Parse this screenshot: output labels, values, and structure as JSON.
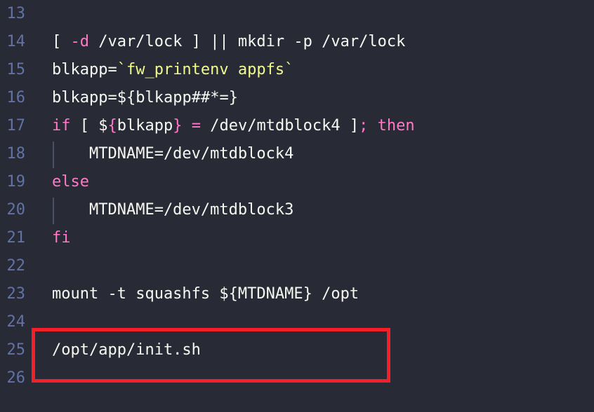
{
  "editor": {
    "background_color": "#282a36",
    "gutter_color": "#6272a4",
    "default_text_color": "#f8f8f2",
    "font_size_px": 22,
    "line_height_px": 40,
    "first_line_number": 13,
    "last_line_number": 26
  },
  "palette": {
    "keyword": "#ff79c6",
    "string": "#f1fa8c",
    "variable": "#bd93f9",
    "operator": "#ff79c6",
    "plain": "#f8f8f2",
    "comment": "#6272a4",
    "annotation_red": "#f42029",
    "indent_guide": "#4b5066"
  },
  "lines": [
    {
      "number": "13",
      "indent_guide": false,
      "tokens": []
    },
    {
      "number": "14",
      "indent_guide": false,
      "tokens": [
        {
          "t": "[ ",
          "c": "plain"
        },
        {
          "t": "-d",
          "c": "keyword"
        },
        {
          "t": " /var/lock ] ",
          "c": "plain"
        },
        {
          "t": "||",
          "c": "operator"
        },
        {
          "t": " mkdir -p /var/lock",
          "c": "plain"
        }
      ]
    },
    {
      "number": "15",
      "indent_guide": false,
      "tokens": [
        {
          "t": "blkapp=",
          "c": "plain"
        },
        {
          "t": "`fw_printenv appfs`",
          "c": "string"
        }
      ]
    },
    {
      "number": "16",
      "indent_guide": false,
      "tokens": [
        {
          "t": "blkapp=",
          "c": "plain"
        },
        {
          "t": "$",
          "c": "variable"
        },
        {
          "t": "{",
          "c": "plain"
        },
        {
          "t": "blkapp",
          "c": "variable"
        },
        {
          "t": "##*=",
          "c": "operator"
        },
        {
          "t": "}",
          "c": "plain"
        }
      ]
    },
    {
      "number": "17",
      "indent_guide": false,
      "tokens": [
        {
          "t": "if",
          "c": "keyword"
        },
        {
          "t": " [ ",
          "c": "plain"
        },
        {
          "t": "$",
          "c": "variable"
        },
        {
          "t": "{",
          "c": "keyword"
        },
        {
          "t": "blkapp",
          "c": "variable"
        },
        {
          "t": "}",
          "c": "keyword"
        },
        {
          "t": " ",
          "c": "plain"
        },
        {
          "t": "=",
          "c": "keyword"
        },
        {
          "t": " /dev/mtdblock4 ]",
          "c": "plain"
        },
        {
          "t": ";",
          "c": "keyword"
        },
        {
          "t": " ",
          "c": "plain"
        },
        {
          "t": "then",
          "c": "keyword"
        }
      ]
    },
    {
      "number": "18",
      "indent_guide": true,
      "tokens": [
        {
          "t": "    MTDNAME=/dev/mtdblock4",
          "c": "plain"
        }
      ]
    },
    {
      "number": "19",
      "indent_guide": false,
      "tokens": [
        {
          "t": "else",
          "c": "keyword"
        }
      ]
    },
    {
      "number": "20",
      "indent_guide": true,
      "tokens": [
        {
          "t": "    MTDNAME=/dev/mtdblock3",
          "c": "plain"
        }
      ]
    },
    {
      "number": "21",
      "indent_guide": false,
      "tokens": [
        {
          "t": "fi",
          "c": "keyword"
        }
      ]
    },
    {
      "number": "22",
      "indent_guide": false,
      "tokens": []
    },
    {
      "number": "23",
      "indent_guide": false,
      "tokens": [
        {
          "t": "mount -t squashfs ",
          "c": "plain"
        },
        {
          "t": "$",
          "c": "variable"
        },
        {
          "t": "{",
          "c": "plain"
        },
        {
          "t": "MTDNAME",
          "c": "variable"
        },
        {
          "t": "}",
          "c": "plain"
        },
        {
          "t": " /opt",
          "c": "plain"
        }
      ]
    },
    {
      "number": "24",
      "indent_guide": false,
      "tokens": []
    },
    {
      "number": "25",
      "indent_guide": false,
      "tokens": [
        {
          "t": "/opt/app/init.sh",
          "c": "plain"
        }
      ]
    },
    {
      "number": "26",
      "indent_guide": false,
      "tokens": []
    }
  ],
  "annotation": {
    "kind": "red-rectangle-highlight",
    "color": "#f42029",
    "covers_lines": [
      "25",
      "26"
    ],
    "highlighted_text": "/opt/app/init.sh"
  }
}
